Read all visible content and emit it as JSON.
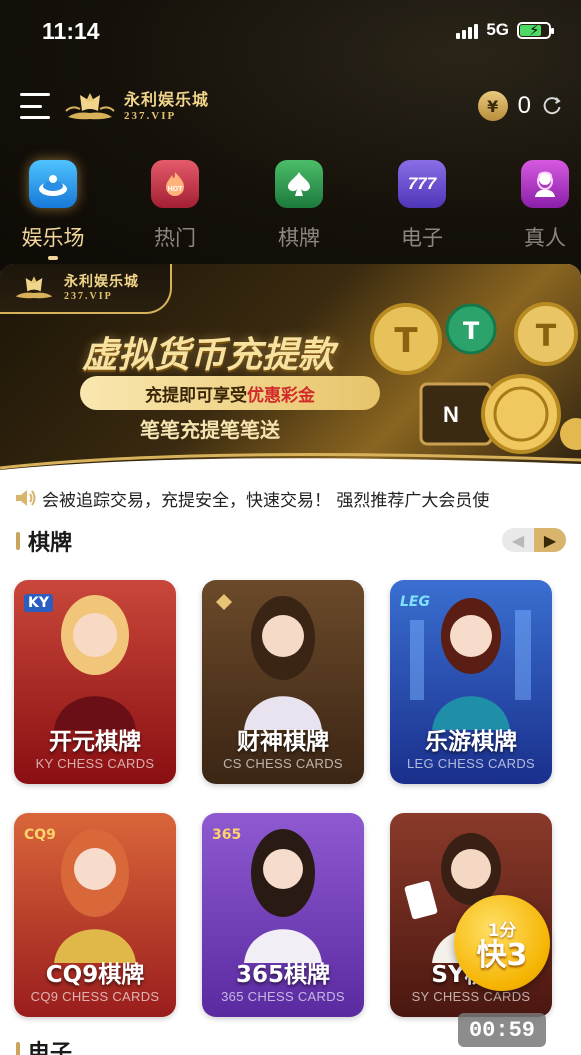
{
  "status_bar": {
    "time": "11:14",
    "network": "5G"
  },
  "header": {
    "logo_cn": "永利娱乐城",
    "logo_sub": "237.VIP",
    "currency_symbol": "¥",
    "balance": "0"
  },
  "categories": [
    {
      "label": "娱乐场",
      "icon": "roulette-icon",
      "active": true
    },
    {
      "label": "热门",
      "icon": "hot-icon"
    },
    {
      "label": "棋牌",
      "icon": "spade-icon"
    },
    {
      "label": "电子",
      "icon": "slot-777-icon"
    },
    {
      "label": "真人",
      "icon": "live-dealer-icon"
    }
  ],
  "banner": {
    "logo_cn": "永利娱乐城",
    "logo_sub": "237.VIP",
    "title": "虚拟货币充提款",
    "pill_prefix": "充提即可享受",
    "pill_highlight": "优惠彩金",
    "subtitle": "笔笔充提笔笔送",
    "coin_label": "N"
  },
  "marquee": {
    "text": "会被追踪交易，充提安全，快速交易！ 强烈推荐广大会员使"
  },
  "sections": [
    {
      "title": "棋牌"
    },
    {
      "title": "电子"
    }
  ],
  "games": [
    {
      "name": "开元棋牌",
      "en": "KY CHESS CARDS",
      "badge": "KY",
      "color_top": "#c9473a",
      "color_bottom": "#8a0f12"
    },
    {
      "name": "财神棋牌",
      "en": "CS CHESS CARDS",
      "badge": "",
      "color_top": "#6b4a2a",
      "color_bottom": "#3b2514"
    },
    {
      "name": "乐游棋牌",
      "en": "LEG CHESS CARDS",
      "badge": "LEG",
      "color_top": "#3a6fd1",
      "color_bottom": "#1a2f8c"
    },
    {
      "name": "CQ9棋牌",
      "en": "CQ9 CHESS CARDS",
      "badge": "CQ9",
      "color_top": "#d9663a",
      "color_bottom": "#9a1d1d"
    },
    {
      "name": "365棋牌",
      "en": "365 CHESS CARDS",
      "badge": "365",
      "color_top": "#8f5ad1",
      "color_bottom": "#5a2aa0"
    },
    {
      "name": "SY棋牌",
      "en": "SY CHESS CARDS",
      "badge": "",
      "color_top": "#8a3a2a",
      "color_bottom": "#4a1710"
    }
  ],
  "float_badge": {
    "top": "1分",
    "main": "快3"
  },
  "timer": "00:59"
}
